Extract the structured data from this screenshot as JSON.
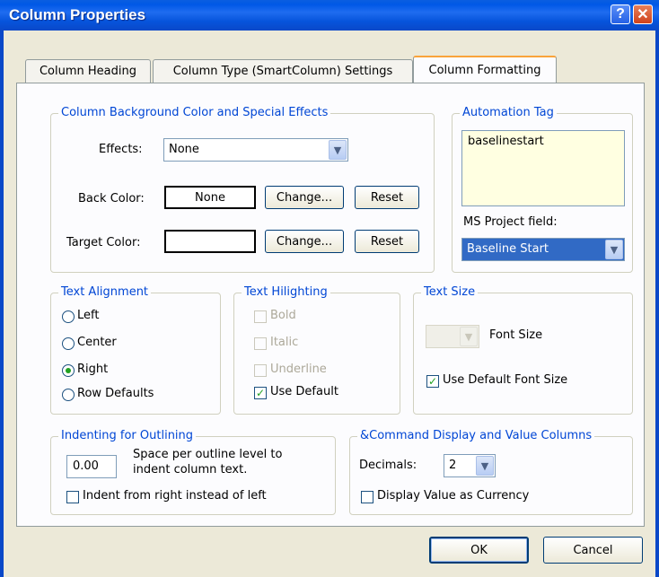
{
  "window": {
    "title": "Column Properties"
  },
  "tabs": [
    "Column Heading",
    "Column Type (SmartColumn) Settings",
    "Column Formatting"
  ],
  "background_group": {
    "title": "Column Background Color and Special Effects",
    "effects_label": "Effects:",
    "effects_value": "None",
    "back_color_label": "Back Color:",
    "back_color_value": "None",
    "target_color_label": "Target Color:",
    "target_color_value": "",
    "change_label": "Change...",
    "reset_label": "Reset"
  },
  "automation": {
    "title": "Automation Tag",
    "tag_value": "baselinestart",
    "ms_project_label": "MS Project field:",
    "ms_project_value": "Baseline Start"
  },
  "alignment": {
    "title": "Text Alignment",
    "options": [
      "Left",
      "Center",
      "Right",
      "Row Defaults"
    ],
    "selected": "Right"
  },
  "hilighting": {
    "title": "Text Hilighting",
    "bold": "Bold",
    "italic": "Italic",
    "underline": "Underline",
    "use_default": "Use Default"
  },
  "text_size": {
    "title": "Text Size",
    "font_size_label": "Font Size",
    "use_default_label": "Use Default Font Size"
  },
  "indenting": {
    "title": "Indenting for Outlining",
    "value": "0.00",
    "desc_line1": "Space per outline level to",
    "desc_line2": "indent column text.",
    "indent_right_label": "Indent from right instead of left"
  },
  "command": {
    "title": "&Command Display and Value Columns",
    "decimals_label": "Decimals:",
    "decimals_value": "2",
    "currency_label": "Display Value as Currency"
  },
  "buttons": {
    "ok": "OK",
    "cancel": "Cancel"
  },
  "colors": {
    "title_bar": "#0058e6",
    "group_title": "#0046d5",
    "dialog_bg": "#ece9d8",
    "tab_highlight": "#f9a33a"
  }
}
